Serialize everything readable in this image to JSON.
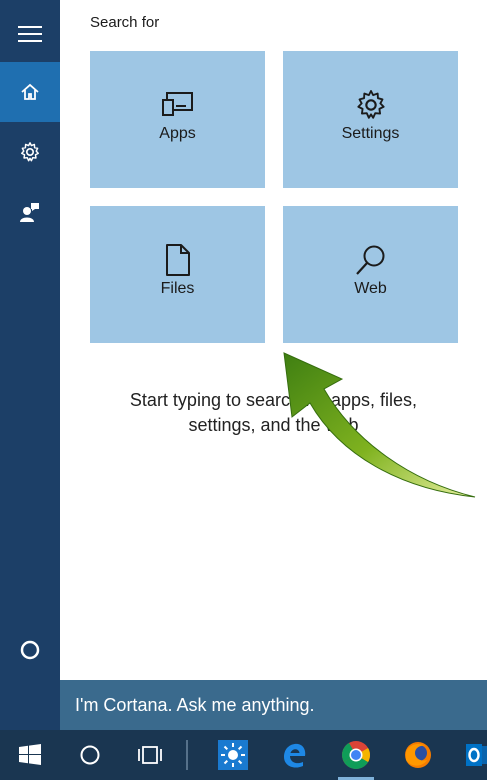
{
  "sidebar": {
    "items": [
      {
        "name": "menu",
        "icon": "hamburger-menu-icon"
      },
      {
        "name": "home",
        "icon": "home-icon",
        "active": true
      },
      {
        "name": "settings",
        "icon": "gear-icon"
      },
      {
        "name": "feedback",
        "icon": "feedback-icon"
      },
      {
        "name": "cortana",
        "icon": "cortana-circle-icon"
      }
    ]
  },
  "main": {
    "search_for_label": "Search for",
    "tiles": [
      {
        "label": "Apps",
        "icon": "apps-icon"
      },
      {
        "label": "Settings",
        "icon": "gear-icon"
      },
      {
        "label": "Files",
        "icon": "file-icon"
      },
      {
        "label": "Web",
        "icon": "search-icon"
      }
    ],
    "hint_line1": "Start typing to search for apps, files,",
    "hint_line2": "settings, and the web"
  },
  "search_bar": {
    "placeholder": "I'm Cortana. Ask me anything."
  },
  "taskbar": {
    "items": [
      {
        "name": "start",
        "icon": "windows-logo-icon"
      },
      {
        "name": "cortana",
        "icon": "cortana-circle-icon"
      },
      {
        "name": "task-view",
        "icon": "task-view-icon"
      },
      {
        "name": "weather-app",
        "icon": "sun-icon"
      },
      {
        "name": "edge",
        "icon": "edge-icon"
      },
      {
        "name": "chrome",
        "icon": "chrome-icon"
      },
      {
        "name": "firefox",
        "icon": "firefox-icon"
      },
      {
        "name": "outlook",
        "icon": "outlook-icon"
      }
    ]
  },
  "colors": {
    "sidebar_bg": "#1c3f67",
    "sidebar_active": "#1f6fb0",
    "tile_bg": "#9ec6e4",
    "search_bar_bg": "#3a6a8d",
    "taskbar_bg": "#1a3651",
    "arrow_green": "#6ea51a"
  }
}
